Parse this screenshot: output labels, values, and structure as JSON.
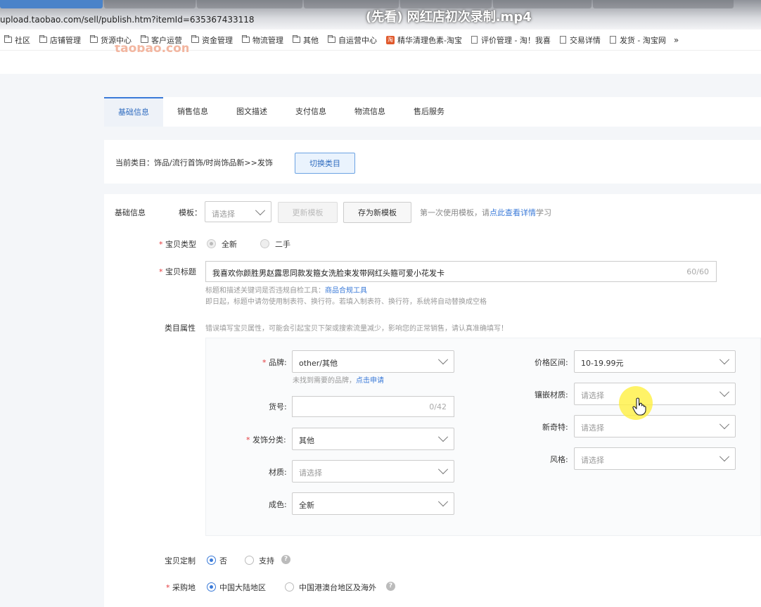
{
  "browser": {
    "url": "upload.taobao.com/sell/publish.htm?itemId=635367433118",
    "video_title": "(先看) 网红店初次录制.mp4"
  },
  "bookmarks": [
    {
      "label": "社区",
      "icon": "folder-icon"
    },
    {
      "label": "店铺管理",
      "icon": "folder-icon"
    },
    {
      "label": "货源中心",
      "icon": "folder-icon"
    },
    {
      "label": "客户运营",
      "icon": "folder-icon"
    },
    {
      "label": "资金管理",
      "icon": "folder-icon"
    },
    {
      "label": "物流管理",
      "icon": "folder-icon"
    },
    {
      "label": "其他",
      "icon": "folder-icon"
    },
    {
      "label": "自运营中心",
      "icon": "folder-icon"
    },
    {
      "label": "精华清理色素-淘宝",
      "icon": "site-icon"
    },
    {
      "label": "评价管理 - 淘！我喜",
      "icon": "page-icon"
    },
    {
      "label": "交易详情",
      "icon": "page-icon"
    },
    {
      "label": "发货 - 淘宝网",
      "icon": "page-icon"
    }
  ],
  "logo_text": "taobao.com",
  "tabs": [
    "基础信息",
    "销售信息",
    "图文描述",
    "支付信息",
    "物流信息",
    "售后服务"
  ],
  "category": {
    "label": "当前类目：饰品/流行首饰/时尚饰品新>>发饰",
    "switch_button": "切换类目"
  },
  "basic_info": {
    "section_label": "基础信息",
    "template_label": "模板：",
    "template_placeholder": "请选择",
    "update_template_button": "更新模板",
    "save_template_button": "存为新模板",
    "template_tip": "第一次使用模板，请",
    "template_tip_link": "点此查看详情",
    "template_tip_end": "学习"
  },
  "item_type": {
    "label": "宝贝类型",
    "options": [
      "全新",
      "二手"
    ],
    "selected": "全新"
  },
  "item_title": {
    "label": "宝贝标题",
    "value": "我喜欢你颜胜男赵露思同款发箍女洗脸束发带网红头箍可爱小花发卡",
    "count": "60/60",
    "hint1": "标题和描述关键词是否违规自检工具：",
    "hint1_link": "商品合规工具",
    "hint2": "即日起，标题中请勿使用制表符、换行符。若填入制表符、换行符，系统将自动替换成空格"
  },
  "attributes": {
    "label": "类目属性",
    "warning": "错误填写宝贝属性，可能会引起宝贝下架或搜索流量减少，影响您的正常销售，请认真准确填写！",
    "brand": {
      "label": "品牌:",
      "value": "other/其他",
      "hint": "未找到需要的品牌，",
      "hint_link": "点击申请"
    },
    "sku": {
      "label": "货号:",
      "count": "0/42"
    },
    "type": {
      "label": "发饰分类:",
      "value": "其他"
    },
    "material": {
      "label": "材质:",
      "placeholder": "请选择"
    },
    "color": {
      "label": "成色:",
      "value": "全新"
    },
    "price_range": {
      "label": "价格区间:",
      "value": "10-19.99元"
    },
    "inlay": {
      "label": "镶嵌材质:",
      "placeholder": "请选择"
    },
    "novelty": {
      "label": "新奇特:",
      "placeholder": "请选择"
    },
    "style": {
      "label": "风格:",
      "placeholder": "请选择"
    }
  },
  "custom": {
    "label": "宝贝定制",
    "options": [
      "否",
      "支持"
    ],
    "selected": "否"
  },
  "origin": {
    "label": "采购地",
    "options": [
      "中国大陆地区",
      "中国港澳台地区及海外"
    ],
    "selected": "中国大陆地区"
  },
  "colors": {
    "accent": "#3a7ad8",
    "required": "#e4393c",
    "cursor_highlight": "#fff03c"
  }
}
